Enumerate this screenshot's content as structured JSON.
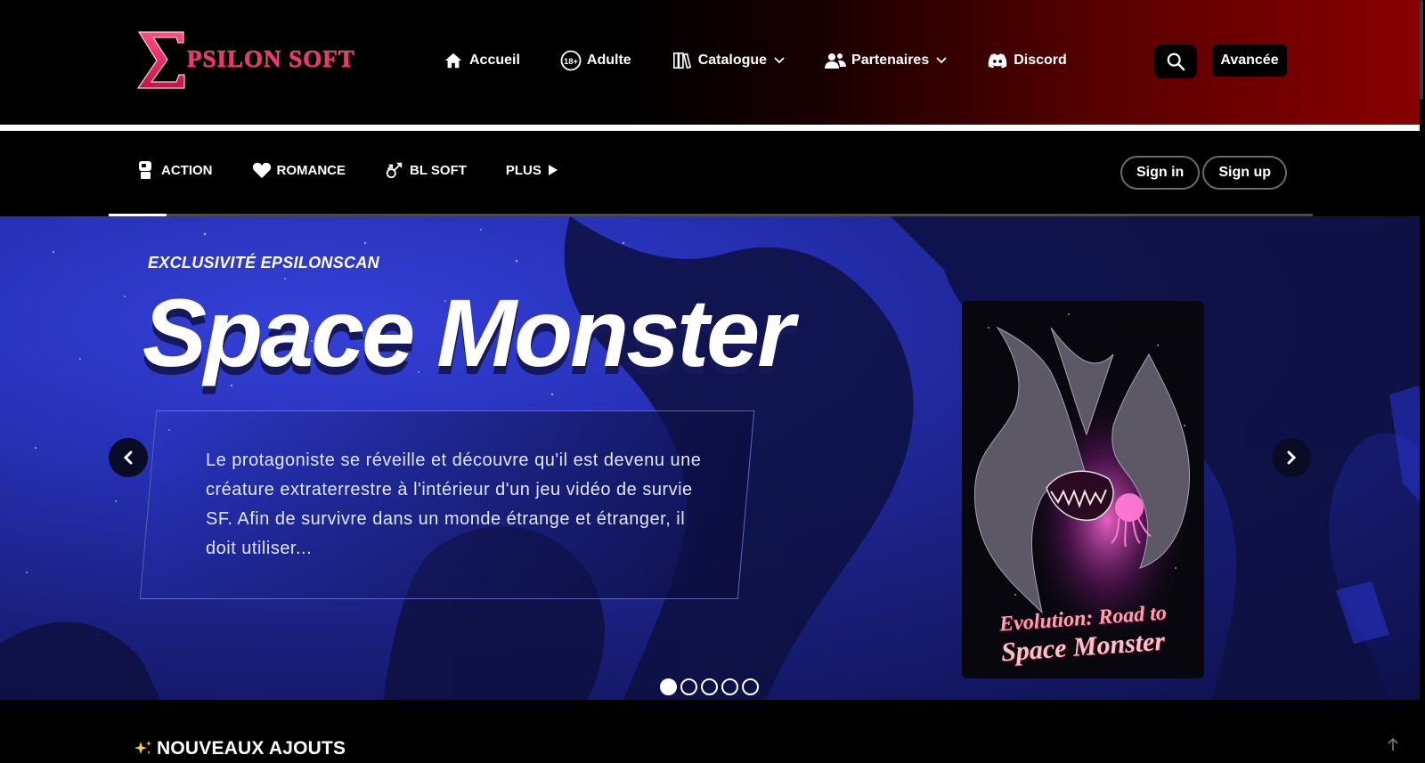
{
  "brand": {
    "logo_letter": "Σ",
    "logo_text": "PSILON SOFT",
    "accent_color": "#ff2d6b"
  },
  "nav": {
    "items": [
      {
        "label": "Accueil",
        "icon": "home-icon"
      },
      {
        "label": "Adulte",
        "icon": "18-plus-icon"
      },
      {
        "label": "Catalogue",
        "icon": "books-icon",
        "dropdown": true
      },
      {
        "label": "Partenaires",
        "icon": "users-icon",
        "dropdown": true
      },
      {
        "label": "Discord",
        "icon": "discord-icon"
      }
    ],
    "search_icon": "search-icon",
    "advanced_label": "Avancée"
  },
  "genres": {
    "items": [
      {
        "label": "ACTION",
        "icon": "fist-icon"
      },
      {
        "label": "ROMANCE",
        "icon": "heart-icon"
      },
      {
        "label": "BL SOFT",
        "icon": "male-symbols-icon"
      },
      {
        "label": "PLUS",
        "icon": "play-icon"
      }
    ]
  },
  "auth": {
    "sign_in": "Sign in",
    "sign_up": "Sign up"
  },
  "slider": {
    "progress": 0.048,
    "kicker": "EXCLUSIVITÉ EPSILONSCAN",
    "title": "Space Monster",
    "description": "Le protagoniste se réveille et découvre qu'il est devenu une créature extraterrestre à l'intérieur d'un jeu vidéo de survie SF. Afin de survivre dans un monde étrange et étranger, il doit utiliser...",
    "cover_title_line1": "Evolution: Road to",
    "cover_title_line2": "Space Monster",
    "slide_count": 5,
    "active_slide": 1
  },
  "section": {
    "title": "NOUVEAUX AJOUTS",
    "icon": "sparkles-icon"
  }
}
